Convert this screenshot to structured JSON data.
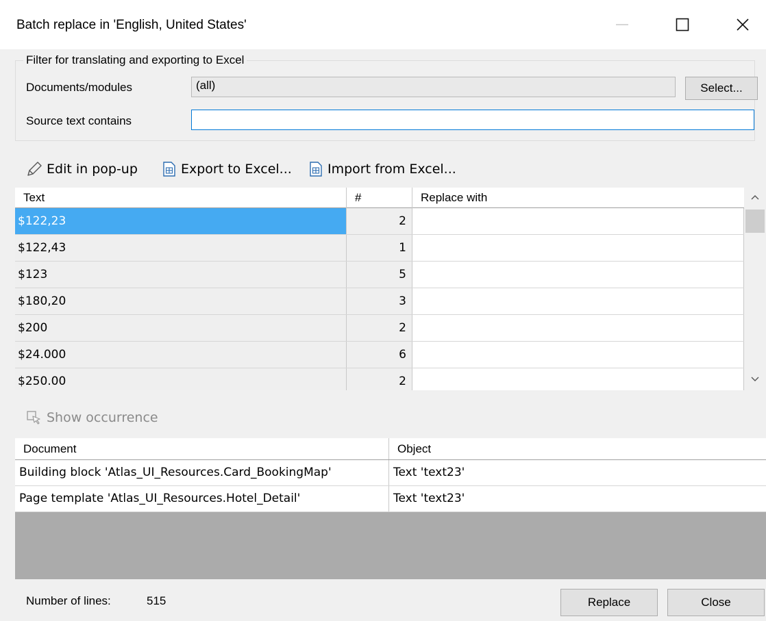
{
  "window": {
    "title": "Batch replace in 'English, United States'",
    "minimize_icon": "minimize-icon",
    "maximize_icon": "maximize-icon",
    "close_icon": "close-icon"
  },
  "filter": {
    "legend": "Filter for translating and exporting to Excel",
    "documents_label": "Documents/modules",
    "documents_value": "(all)",
    "select_button": "Select...",
    "source_label": "Source text contains",
    "source_value": "",
    "source_placeholder": ""
  },
  "toolbar": {
    "edit": "Edit in pop-up",
    "export": "Export to Excel...",
    "import": "Import from Excel..."
  },
  "grid": {
    "columns": {
      "text": "Text",
      "count": "#",
      "replace": "Replace with"
    },
    "rows": [
      {
        "text": "$122,23",
        "count": "2",
        "replace": "",
        "selected": true
      },
      {
        "text": "$122,43",
        "count": "1",
        "replace": ""
      },
      {
        "text": "$123",
        "count": "5",
        "replace": ""
      },
      {
        "text": "$180,20",
        "count": "3",
        "replace": ""
      },
      {
        "text": "$200",
        "count": "2",
        "replace": ""
      },
      {
        "text": "$24.000",
        "count": "6",
        "replace": ""
      },
      {
        "text": "$250.00",
        "count": "2",
        "replace": ""
      }
    ]
  },
  "occurrence": {
    "button": "Show occurrence",
    "columns": {
      "document": "Document",
      "object": "Object"
    },
    "rows": [
      {
        "document": "Building block 'Atlas_UI_Resources.Card_BookingMap'",
        "object": "Text 'text23'"
      },
      {
        "document": "Page template 'Atlas_UI_Resources.Hotel_Detail'",
        "object": "Text 'text23'"
      }
    ]
  },
  "footer": {
    "lines_label": "Number of lines:",
    "lines_value": "515",
    "replace_button": "Replace",
    "close_button": "Close"
  },
  "colors": {
    "selection": "#45aaf2",
    "input_focus": "#0078d7",
    "disabled_text": "#8a8a8a"
  }
}
